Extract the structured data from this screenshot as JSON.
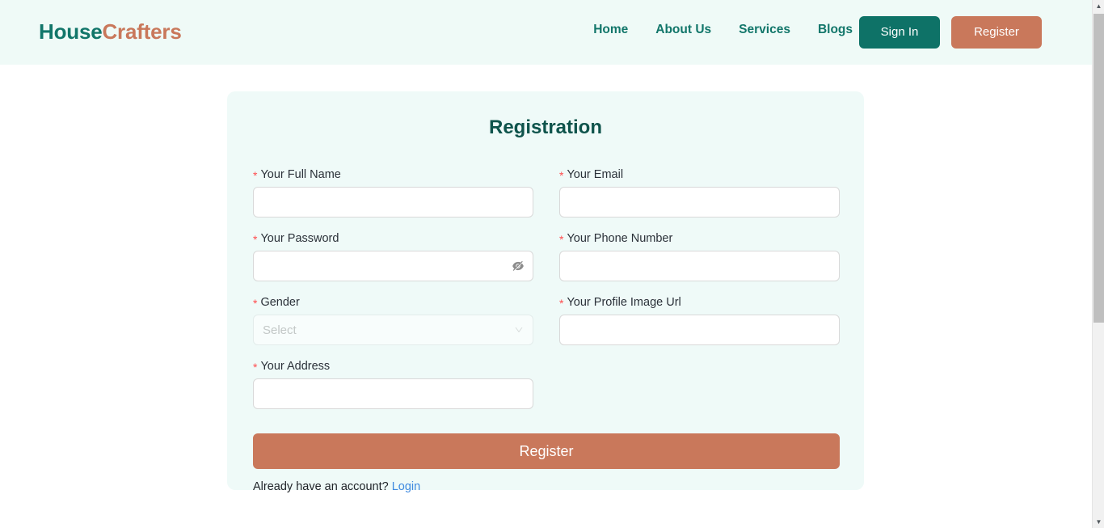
{
  "header": {
    "brand_part1": "House",
    "brand_part2": "Crafters",
    "nav": [
      {
        "label": "Home"
      },
      {
        "label": "About Us"
      },
      {
        "label": "Services"
      },
      {
        "label": "Blogs"
      }
    ],
    "sign_in_label": "Sign In",
    "register_label": "Register"
  },
  "card": {
    "title": "Registration",
    "required_marker": "*",
    "fields": {
      "full_name": {
        "label": "Your Full Name",
        "value": "",
        "placeholder": ""
      },
      "email": {
        "label": "Your Email",
        "value": "",
        "placeholder": ""
      },
      "password": {
        "label": "Your Password",
        "value": "",
        "placeholder": "",
        "toggle_icon": "eye-invisible-icon"
      },
      "phone": {
        "label": "Your Phone Number",
        "value": "",
        "placeholder": ""
      },
      "gender": {
        "label": "Gender",
        "selected": "Select",
        "dropdown_icon": "chevron-down-icon"
      },
      "profile_image_url": {
        "label": "Your Profile Image Url",
        "value": "",
        "placeholder": ""
      },
      "address": {
        "label": "Your Address",
        "value": "",
        "placeholder": ""
      }
    },
    "submit_label": "Register",
    "login_prompt": "Already have an account?",
    "login_link": "Login"
  },
  "scrollbar": {
    "up_arrow": "▲",
    "down_arrow": "▼"
  },
  "colors": {
    "brand_teal": "#12766a",
    "brand_terracotta": "#c9785b",
    "header_bg": "#effaf7",
    "card_bg": "#effaf8",
    "title_teal": "#0f544c",
    "required_red": "#ff4d4f",
    "link_blue": "#3f8ae0",
    "page_bg": "#ffffff"
  }
}
